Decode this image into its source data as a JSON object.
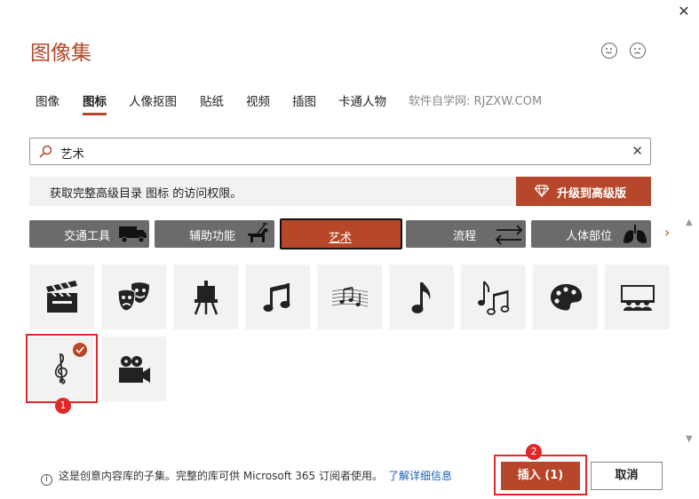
{
  "dialog": {
    "title": "图像集",
    "close_glyph": "✕",
    "feedback_happy": "smile-icon",
    "feedback_sad": "frown-icon"
  },
  "tabs": [
    {
      "label": "图像",
      "active": false
    },
    {
      "label": "图标",
      "active": true
    },
    {
      "label": "人像抠图",
      "active": false
    },
    {
      "label": "贴纸",
      "active": false
    },
    {
      "label": "视频",
      "active": false
    },
    {
      "label": "插图",
      "active": false
    },
    {
      "label": "卡通人物",
      "active": false
    }
  ],
  "watermark": "软件自学网: RJZXW.COM",
  "search": {
    "value": "艺术",
    "clear_glyph": "✕"
  },
  "banner": {
    "text": "获取完整高级目录 图标 的访问权限。",
    "upgrade_label": "升级到高级版"
  },
  "categories": [
    {
      "label": "交通工具",
      "icon": "truck-icon"
    },
    {
      "label": "辅助功能",
      "icon": "guide-dog-icon"
    },
    {
      "label": "艺术",
      "icon": "",
      "selected": true
    },
    {
      "label": "流程",
      "icon": "arrows-exchange-icon"
    },
    {
      "label": "人体部位",
      "icon": "lungs-icon"
    }
  ],
  "categories_next_glyph": "›",
  "icons": [
    {
      "name": "clapperboard-icon"
    },
    {
      "name": "theater-masks-icon"
    },
    {
      "name": "easel-icon"
    },
    {
      "name": "beamed-notes-icon"
    },
    {
      "name": "sheet-music-icon"
    },
    {
      "name": "eighth-note-icon"
    },
    {
      "name": "music-notes-icon"
    },
    {
      "name": "palette-icon"
    },
    {
      "name": "cinema-audience-icon"
    },
    {
      "name": "treble-clef-icon",
      "selected": true
    },
    {
      "name": "movie-camera-icon"
    }
  ],
  "annotations": [
    "1",
    "2"
  ],
  "footer": {
    "info_glyph": "i",
    "info_text": "这是创意内容库的子集。完整的库可供 Microsoft 365 订阅者使用。",
    "link_text": "了解详细信息",
    "insert_label": "插入 (1)",
    "cancel_label": "取消"
  },
  "colors": {
    "accent": "#b7472a",
    "category_bg": "#6b6b6b",
    "annotation_red": "#e02828",
    "link": "#1a5fb4"
  }
}
